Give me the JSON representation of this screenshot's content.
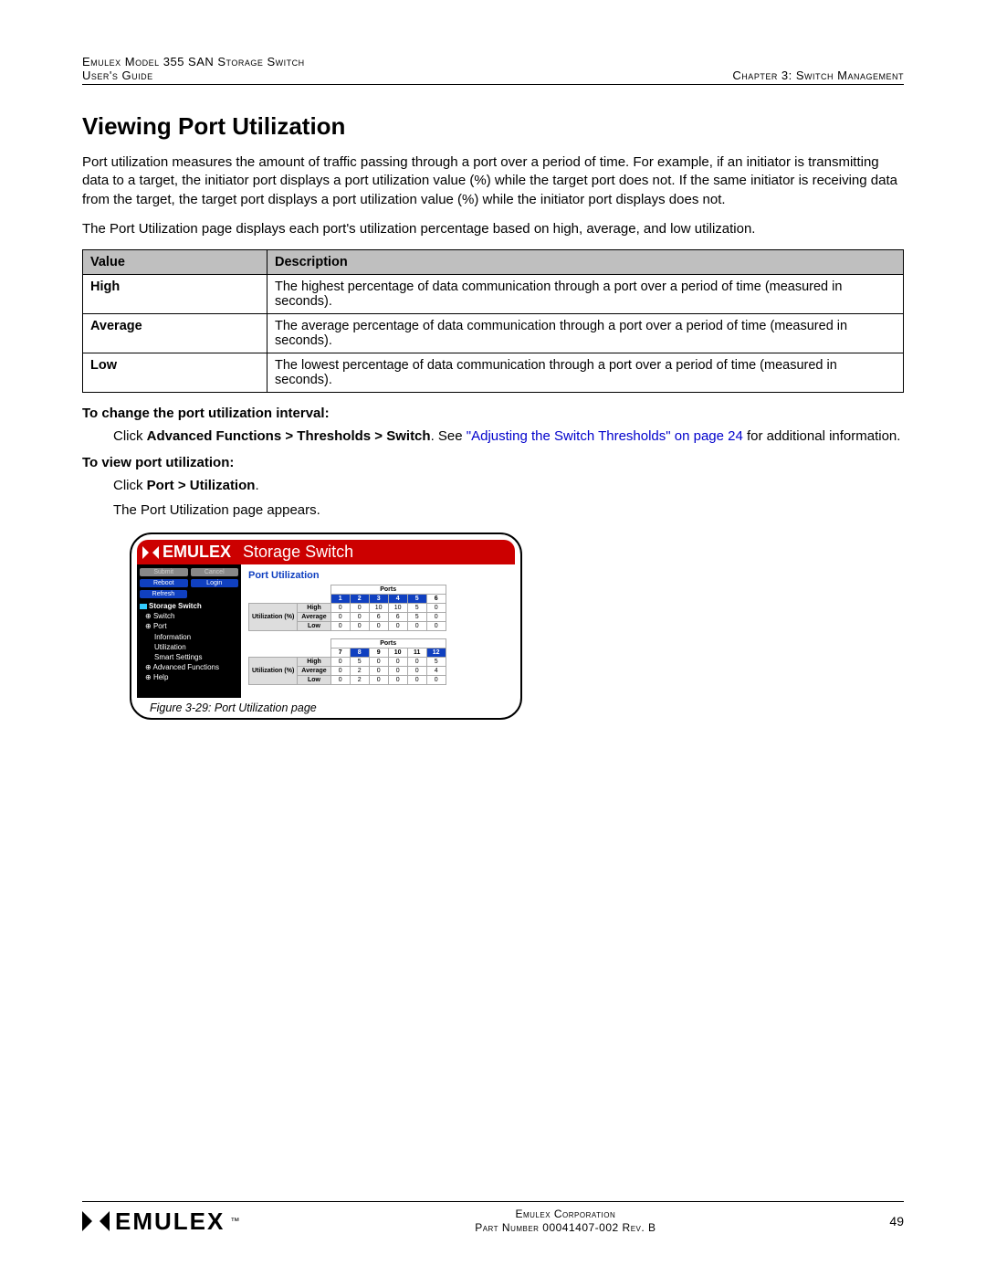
{
  "header": {
    "left_line1": "Emulex Model 355 SAN Storage Switch",
    "left_line2": "User's Guide",
    "right_line2": "Chapter 3: Switch Management"
  },
  "title": "Viewing Port Utilization",
  "para1": "Port utilization measures the amount of traffic passing through a port over a period of time. For example, if an initiator is transmitting data to a target, the initiator port displays a port utilization value (%) while the target port does not. If the same initiator is receiving data from the target, the target port displays a port utilization value (%) while the initiator port displays does not.",
  "para2": "The Port Utilization page displays each port's utilization percentage based on high, average, and low utilization.",
  "table": {
    "col1": "Value",
    "col2": "Description",
    "rows": [
      {
        "v": "High",
        "d": "The highest percentage of data communication through a port over a period of time (measured in seconds)."
      },
      {
        "v": "Average",
        "d": "The average percentage of data communication through a port over a period of time (measured in seconds)."
      },
      {
        "v": "Low",
        "d": "The lowest percentage of data communication through a port over a period of time (measured in seconds)."
      }
    ]
  },
  "proc1": {
    "heading": "To change the port utilization interval:",
    "line1a": "Click ",
    "line1b": "Advanced Functions > Thresholds > Switch",
    "line1c": ". See ",
    "link": "\"Adjusting the Switch Thresholds\" on page 24",
    "line1d": " for additional information."
  },
  "proc2": {
    "heading": "To view port utilization:",
    "line1a": "Click ",
    "line1b": "Port > Utilization",
    "line1c": ".",
    "line2": "The Port Utilization page appears."
  },
  "screenshot": {
    "brand_prefix": "EMULEX",
    "brand_suffix": "Storage Switch",
    "sidebar_buttons": {
      "submit": "Submit",
      "cancel": "Cancel",
      "reboot": "Reboot",
      "login": "Login",
      "refresh": "Refresh"
    },
    "tree": {
      "root": "Storage Switch",
      "switch": "Switch",
      "port": "Port",
      "information": "Information",
      "utilization": "Utilization",
      "smart": "Smart Settings",
      "adv": "Advanced Functions",
      "help": "Help"
    },
    "main_title": "Port Utilization",
    "ports_label": "Ports",
    "util_label": "Utilization (%)",
    "rows": [
      "High",
      "Average",
      "Low"
    ],
    "group1": {
      "ports": [
        "1",
        "2",
        "3",
        "4",
        "5",
        "6"
      ],
      "data": {
        "High": [
          "0",
          "0",
          "10",
          "10",
          "5",
          "0"
        ],
        "Average": [
          "0",
          "0",
          "6",
          "6",
          "5",
          "0"
        ],
        "Low": [
          "0",
          "0",
          "0",
          "0",
          "0",
          "0"
        ]
      }
    },
    "group2": {
      "ports": [
        "7",
        "8",
        "9",
        "10",
        "11",
        "12"
      ],
      "data": {
        "High": [
          "0",
          "5",
          "0",
          "0",
          "0",
          "5"
        ],
        "Average": [
          "0",
          "2",
          "0",
          "0",
          "0",
          "4"
        ],
        "Low": [
          "0",
          "2",
          "0",
          "0",
          "0",
          "0"
        ]
      }
    },
    "caption": "Figure 3-29: Port Utilization page"
  },
  "footer": {
    "brand": "EMULEX",
    "tm": "™",
    "line1": "Emulex Corporation",
    "line2": "Part Number 00041407-002 Rev. B",
    "page": "49"
  }
}
